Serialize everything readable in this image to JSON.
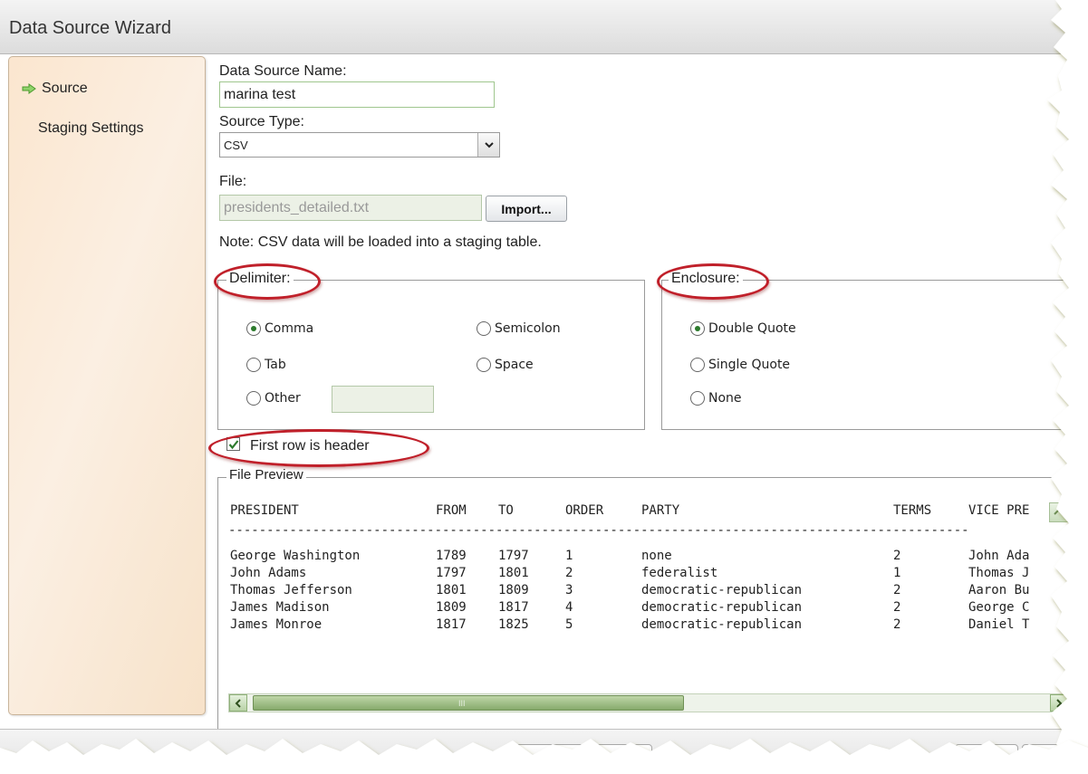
{
  "window": {
    "title": "Data Source Wizard"
  },
  "sidebar": {
    "items": [
      {
        "label": "Source",
        "active": true,
        "icon": "arrow-right-icon"
      },
      {
        "label": "Staging Settings",
        "active": false
      }
    ]
  },
  "form": {
    "name_label": "Data Source Name:",
    "name_value": "marina test",
    "type_label": "Source Type:",
    "type_value": "CSV",
    "file_label": "File:",
    "file_value": "presidents_detailed.txt",
    "import_label": "Import...",
    "note": "Note: CSV data will be loaded into a staging table."
  },
  "delimiter": {
    "legend": "Delimiter:",
    "options": [
      {
        "label": "Comma",
        "checked": true
      },
      {
        "label": "Semicolon",
        "checked": false
      },
      {
        "label": "Tab",
        "checked": false
      },
      {
        "label": "Space",
        "checked": false
      },
      {
        "label": "Other",
        "checked": false
      }
    ],
    "other_value": ""
  },
  "enclosure": {
    "legend": "Enclosure:",
    "options": [
      {
        "label": "Double Quote",
        "checked": true
      },
      {
        "label": "Single Quote",
        "checked": false
      },
      {
        "label": "None",
        "checked": false
      }
    ]
  },
  "header_checkbox": {
    "label": "First row is header",
    "checked": true
  },
  "preview": {
    "legend": "File Preview",
    "columns": [
      "PRESIDENT",
      "FROM",
      "TO",
      "ORDER",
      "PARTY",
      "TERMS",
      "VICE PRE"
    ],
    "separator": "-------------------------------------------------------------------------------------------------",
    "rows": [
      [
        "George Washington",
        "1789",
        "1797",
        "1",
        "none",
        "2",
        "John Ada"
      ],
      [
        "John Adams",
        "1797",
        "1801",
        "2",
        "federalist",
        "1",
        "Thomas J"
      ],
      [
        "Thomas Jefferson",
        "1801",
        "1809",
        "3",
        "democratic-republican",
        "2",
        "Aaron Bu"
      ],
      [
        "James Madison",
        "1809",
        "1817",
        "4",
        "democratic-republican",
        "2",
        "George C"
      ],
      [
        "James Monroe",
        "1817",
        "1825",
        "5",
        "democratic-republican",
        "2",
        "Daniel T"
      ]
    ],
    "scroll_grip": "III"
  },
  "colors": {
    "accent_green": "#2c7a2c",
    "annotation_red": "#c0202a",
    "panel_peach": "#fbe6cf"
  }
}
